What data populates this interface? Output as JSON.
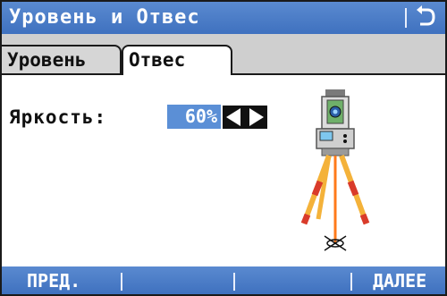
{
  "window": {
    "title": "Уровень и Отвес"
  },
  "tabs": [
    {
      "label": "Уровень",
      "active": false
    },
    {
      "label": "Отвес",
      "active": true
    }
  ],
  "brightness": {
    "label": "Яркость:",
    "value": "60%"
  },
  "softkeys": {
    "left": "ПРЕД.",
    "right": "ДАЛЕЕ"
  },
  "colors": {
    "bar_blue": "#4a7cc8",
    "value_blue": "#5b8fd6",
    "laser_orange": "#ff7a1a",
    "tripod_yellow": "#f4b23a"
  }
}
